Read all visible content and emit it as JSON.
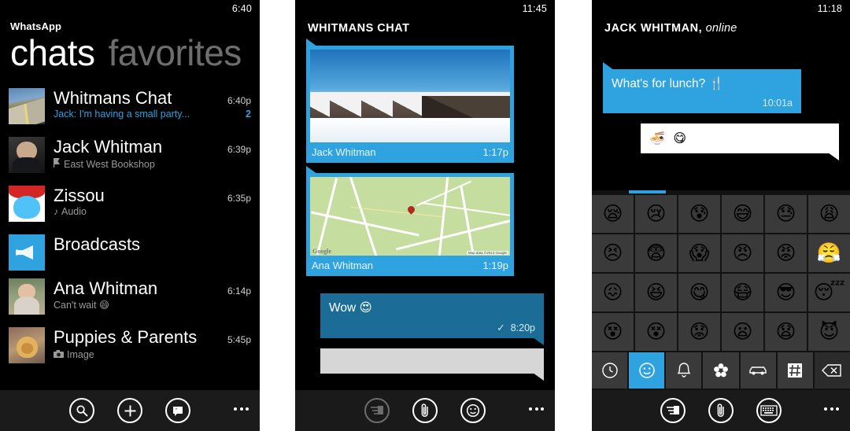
{
  "panels": {
    "chats": {
      "status_time": "6:40",
      "app_name": "WhatsApp",
      "pivot_active": "chats",
      "pivot_inactive": "favorites",
      "rows": [
        {
          "name": "Whitmans Chat",
          "time": "6:40p",
          "message": "Jack: I'm having a small party...",
          "badge": "2",
          "unread": true,
          "icon": "",
          "avatar": "av-road"
        },
        {
          "name": "Jack Whitman",
          "time": "6:39p",
          "message": "East West Bookshop",
          "badge": "",
          "unread": false,
          "icon": "location-icon",
          "avatar": "av-jack"
        },
        {
          "name": "Zissou",
          "time": "6:35p",
          "message": "Audio",
          "badge": "",
          "unread": false,
          "icon": "music-note-icon",
          "avatar": "av-smurf"
        },
        {
          "name": "Broadcasts",
          "time": "",
          "message": "",
          "badge": "",
          "unread": false,
          "icon": "",
          "avatar": "av-broadcast"
        },
        {
          "name": "Ana Whitman",
          "time": "6:14p",
          "message": "Can't wait 😄",
          "badge": "",
          "unread": false,
          "icon": "",
          "avatar": "av-ana"
        },
        {
          "name": "Puppies & Parents",
          "time": "5:45p",
          "message": "Image",
          "badge": "",
          "unread": false,
          "icon": "camera-icon",
          "avatar": "av-pup"
        }
      ],
      "appbar": {
        "search": "search-icon",
        "new": "plus-icon",
        "broadcast": "broadcast-icon",
        "more": "more-icon"
      }
    },
    "thread": {
      "status_time": "11:45",
      "title": "WHITMANS CHAT",
      "messages": [
        {
          "kind": "photo",
          "sender": "Jack Whitman",
          "time": "1:17p"
        },
        {
          "kind": "map",
          "sender": "Ana Whitman",
          "time": "1:19p"
        },
        {
          "kind": "text",
          "text": "Wow 😍",
          "time": "8:20p",
          "check": "✓"
        },
        {
          "kind": "empty"
        }
      ],
      "appbar": {
        "send": "send-icon",
        "attach": "paperclip-icon",
        "emoji": "smiley-icon",
        "more": "more-icon"
      }
    },
    "emoji": {
      "status_time": "11:18",
      "contact": "JACK WHITMAN,",
      "presence": "online",
      "messages": [
        {
          "kind": "in",
          "text": "What's for lunch? 🍴",
          "time": "10:01a"
        },
        {
          "kind": "compose",
          "text": "🍜 😋"
        }
      ],
      "grid": [
        "😪",
        "😢",
        "😰",
        "😅",
        "😓",
        "😩",
        "😣",
        "😨",
        "😱",
        "😠",
        "😡",
        "😤",
        "😖",
        "😆",
        "😋",
        "😷",
        "😎",
        "😴",
        "😵",
        "😵",
        "😟",
        "😦",
        "😧",
        "😈"
      ],
      "categories": [
        {
          "icon": "clock-icon",
          "selected": false
        },
        {
          "icon": "smiley-icon",
          "selected": true
        },
        {
          "icon": "bell-icon",
          "selected": false
        },
        {
          "icon": "flower-icon",
          "selected": false
        },
        {
          "icon": "car-icon",
          "selected": false
        },
        {
          "icon": "hash-icon",
          "selected": false
        },
        {
          "icon": "backspace-icon",
          "selected": false
        }
      ],
      "appbar": {
        "send": "send-icon",
        "attach": "paperclip-icon",
        "keyboard": "keyboard-icon",
        "more": "more-icon"
      }
    }
  },
  "colors": {
    "accent": "#2fa2e0",
    "accent_dark": "#1b6d97",
    "background": "#000000",
    "gap": "#ffffff"
  }
}
